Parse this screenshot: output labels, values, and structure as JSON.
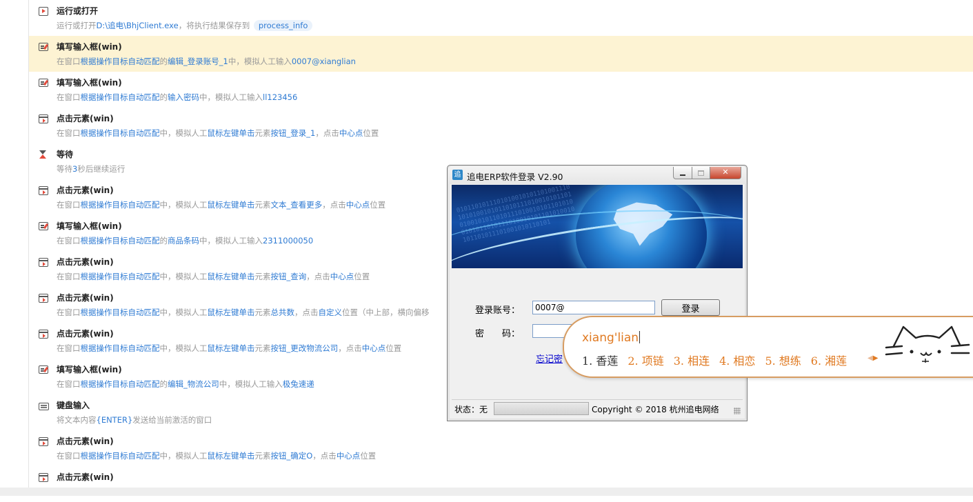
{
  "steps": [
    {
      "icon": "run",
      "title": "运行或打开",
      "desc": [
        {
          "t": "运行或打开"
        },
        {
          "t": "D:\\追电\\BhjClient.exe",
          "h": true
        },
        {
          "t": "，将执行结果保存到 "
        },
        {
          "t": "process_info",
          "pill": true
        }
      ]
    },
    {
      "icon": "edit",
      "title": "填写输入框(win)",
      "highlight": true,
      "desc": [
        {
          "t": "在窗口"
        },
        {
          "t": "根据操作目标自动匹配",
          "h": true
        },
        {
          "t": "的"
        },
        {
          "t": "编辑_登录账号_1",
          "h": true
        },
        {
          "t": "中，模拟人工输入"
        },
        {
          "t": "0007@xianglian",
          "h": true
        }
      ]
    },
    {
      "icon": "edit",
      "title": "填写输入框(win)",
      "desc": [
        {
          "t": "在窗口"
        },
        {
          "t": "根据操作目标自动匹配",
          "h": true
        },
        {
          "t": "的"
        },
        {
          "t": "输入密码",
          "h": true
        },
        {
          "t": "中，模拟人工输入"
        },
        {
          "t": "ll123456",
          "h": true
        }
      ]
    },
    {
      "icon": "click",
      "title": "点击元素(win)",
      "desc": [
        {
          "t": "在窗口"
        },
        {
          "t": "根据操作目标自动匹配",
          "h": true
        },
        {
          "t": "中，模拟人工"
        },
        {
          "t": "鼠标左键单击",
          "h": true
        },
        {
          "t": "元素"
        },
        {
          "t": "按钮_登录_1",
          "h": true
        },
        {
          "t": "，点击"
        },
        {
          "t": "中心点",
          "h": true
        },
        {
          "t": "位置"
        }
      ]
    },
    {
      "icon": "wait",
      "title": "等待",
      "desc": [
        {
          "t": "等待"
        },
        {
          "t": "3",
          "h": true
        },
        {
          "t": "秒后继续运行"
        }
      ]
    },
    {
      "icon": "click",
      "title": "点击元素(win)",
      "desc": [
        {
          "t": "在窗口"
        },
        {
          "t": "根据操作目标自动匹配",
          "h": true
        },
        {
          "t": "中，模拟人工"
        },
        {
          "t": "鼠标左键单击",
          "h": true
        },
        {
          "t": "元素"
        },
        {
          "t": "文本_查看更多",
          "h": true
        },
        {
          "t": "，点击"
        },
        {
          "t": "中心点",
          "h": true
        },
        {
          "t": "位置"
        }
      ]
    },
    {
      "icon": "edit",
      "title": "填写输入框(win)",
      "desc": [
        {
          "t": "在窗口"
        },
        {
          "t": "根据操作目标自动匹配",
          "h": true
        },
        {
          "t": "的"
        },
        {
          "t": "商品条码",
          "h": true
        },
        {
          "t": "中，模拟人工输入"
        },
        {
          "t": "2311000050",
          "h": true
        }
      ]
    },
    {
      "icon": "click",
      "title": "点击元素(win)",
      "desc": [
        {
          "t": "在窗口"
        },
        {
          "t": "根据操作目标自动匹配",
          "h": true
        },
        {
          "t": "中，模拟人工"
        },
        {
          "t": "鼠标左键单击",
          "h": true
        },
        {
          "t": "元素"
        },
        {
          "t": "按钮_查询",
          "h": true
        },
        {
          "t": "，点击"
        },
        {
          "t": "中心点",
          "h": true
        },
        {
          "t": "位置"
        }
      ]
    },
    {
      "icon": "click",
      "title": "点击元素(win)",
      "desc": [
        {
          "t": "在窗口"
        },
        {
          "t": "根据操作目标自动匹配",
          "h": true
        },
        {
          "t": "中，模拟人工"
        },
        {
          "t": "鼠标左键单击",
          "h": true
        },
        {
          "t": "元素"
        },
        {
          "t": "总共数",
          "h": true
        },
        {
          "t": "，点击"
        },
        {
          "t": "自定义",
          "h": true
        },
        {
          "t": "位置（中上部，横向偏移"
        }
      ]
    },
    {
      "icon": "click",
      "title": "点击元素(win)",
      "desc": [
        {
          "t": "在窗口"
        },
        {
          "t": "根据操作目标自动匹配",
          "h": true
        },
        {
          "t": "中，模拟人工"
        },
        {
          "t": "鼠标左键单击",
          "h": true
        },
        {
          "t": "元素"
        },
        {
          "t": "按钮_更改物流公司",
          "h": true
        },
        {
          "t": "，点击"
        },
        {
          "t": "中心点",
          "h": true
        },
        {
          "t": "位置"
        }
      ]
    },
    {
      "icon": "edit",
      "title": "填写输入框(win)",
      "desc": [
        {
          "t": "在窗口"
        },
        {
          "t": "根据操作目标自动匹配",
          "h": true
        },
        {
          "t": "的"
        },
        {
          "t": "编辑_物流公司",
          "h": true
        },
        {
          "t": "中，模拟人工输入"
        },
        {
          "t": "极兔速递",
          "h": true
        }
      ]
    },
    {
      "icon": "key",
      "title": "键盘输入",
      "desc": [
        {
          "t": "将文本内容"
        },
        {
          "t": "{ENTER}",
          "h": true
        },
        {
          "t": "发送给当前激活的窗口"
        }
      ]
    },
    {
      "icon": "click",
      "title": "点击元素(win)",
      "desc": [
        {
          "t": "在窗口"
        },
        {
          "t": "根据操作目标自动匹配",
          "h": true
        },
        {
          "t": "中，模拟人工"
        },
        {
          "t": "鼠标左键单击",
          "h": true
        },
        {
          "t": "元素"
        },
        {
          "t": "按钮_确定O",
          "h": true
        },
        {
          "t": "，点击"
        },
        {
          "t": "中心点",
          "h": true
        },
        {
          "t": "位置"
        }
      ]
    },
    {
      "icon": "click",
      "title": "点击元素(win)",
      "desc": []
    }
  ],
  "dialog": {
    "title": "追电ERP软件登录 V2.90",
    "app_icon_glyph": "追",
    "account_label": "登录账号：",
    "account_value": "0007@",
    "password_label": "密　　码：",
    "password_value": "",
    "login_button": "登录",
    "forgot_link": "忘记密",
    "status_label": "状态：无",
    "copyright": "Copyright © 2018 杭州追电网络"
  },
  "ime": {
    "pinyin": "xiang'lian",
    "candidates": [
      "1. 香莲",
      "2. 项链",
      "3. 相连",
      "4. 相恋",
      "5. 想练",
      "6. 湘莲"
    ],
    "nav_prev": "◀",
    "nav_next": "▶"
  },
  "colors": {
    "highlight_row": "#fdf3d3",
    "link_blue": "#2f7bd3",
    "ime_orange": "#e07a22"
  }
}
